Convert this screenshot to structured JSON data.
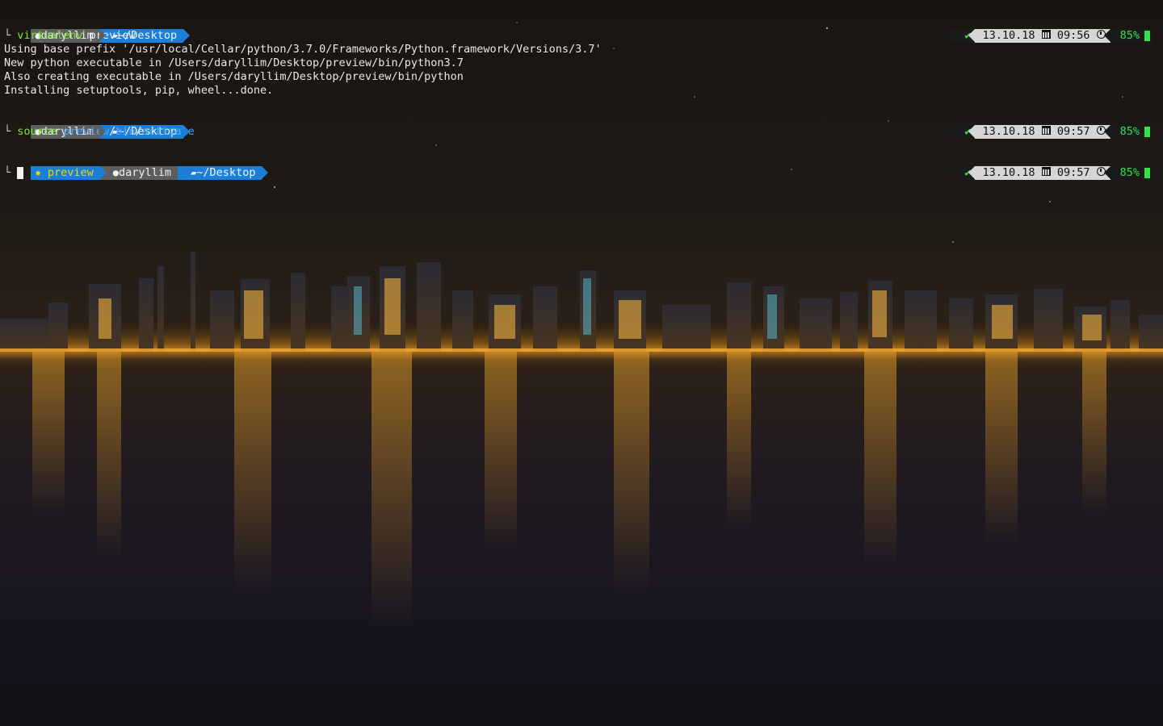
{
  "colors": {
    "user_segment_bg": "#5e5e5e",
    "dir_segment_bg": "#1b7fd8",
    "command_green": "#7fe63a",
    "path_blue": "#4ea7ff",
    "status_ok_green": "#3fe03a",
    "battery_green": "#36e24a",
    "venv_yellow": "#f1d600"
  },
  "icons": {
    "apple": "apple-icon",
    "folder": "folder-icon",
    "python": "python-icon",
    "check": "checkmark-icon",
    "calendar": "calendar-icon",
    "clock": "clock-icon",
    "battery": "battery-icon"
  },
  "blocks": [
    {
      "user": "daryllim",
      "dir": "~/Desktop",
      "command": {
        "tool": "virtualenv",
        "args": " preview"
      },
      "status": {
        "date": "13.10.18",
        "time": "09:56",
        "battery": "85%"
      },
      "output": [
        "Using base prefix '/usr/local/Cellar/python/3.7.0/Frameworks/Python.framework/Versions/3.7'",
        "New python executable in /Users/daryllim/Desktop/preview/bin/python3.7",
        "Also creating executable in /Users/daryllim/Desktop/preview/bin/python",
        "Installing setuptools, pip, wheel...done."
      ]
    },
    {
      "user": "daryllim",
      "dir": "~/Desktop",
      "command": {
        "tool": "source",
        "path_parts": [
          "preview",
          "/",
          "bin",
          "/",
          "activate"
        ]
      },
      "status": {
        "date": "13.10.18",
        "time": "09:57",
        "battery": "85%"
      }
    },
    {
      "venv": "preview",
      "user": "daryllim",
      "dir": "~/Desktop",
      "status": {
        "date": "13.10.18",
        "time": "09:57",
        "battery": "85%"
      }
    }
  ]
}
